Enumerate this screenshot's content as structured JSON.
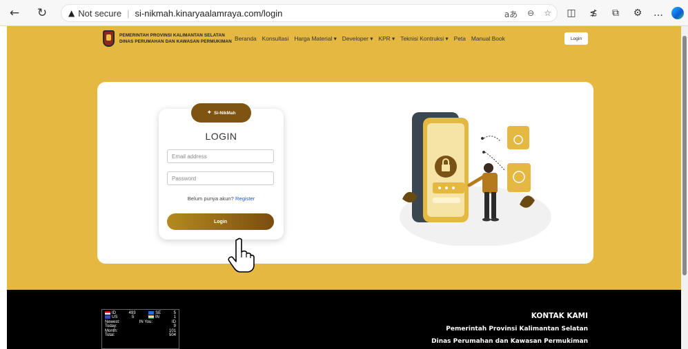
{
  "browser": {
    "security_text": "Not secure",
    "url": "si-nikmah.kinaryaalamraya.com/login",
    "icons": [
      "back-arrow-icon",
      "reload-icon",
      "warning-icon",
      "read-aloud-icon",
      "zoom-icon",
      "favorite-icon",
      "split-screen-icon",
      "favorites-list-icon",
      "collections-icon",
      "extensions-icon",
      "more-icon",
      "edge-copilot-icon"
    ]
  },
  "header": {
    "org_line1": "PEMERINTAH PROVINSI KALIMANTAN SELATAN",
    "org_line2": "DINAS PERUMAHAN DAN KAWASAN PERMUKIMAN",
    "menu": [
      "Beranda",
      "Konsultasi",
      "Harga Material ▾",
      "Developer ▾",
      "KPR ▾",
      "Teknisi Kontruksi ▾",
      "Peta",
      "Manual Book"
    ],
    "login_label": "Login"
  },
  "login": {
    "brand": "Si-NikMah",
    "title": "LOGIN",
    "email_placeholder": "Email address",
    "password_placeholder": "Password",
    "register_prompt": "Belum punya akun?",
    "register_link": "Register",
    "submit_label": "Login"
  },
  "footer": {
    "counter": {
      "rows": [
        [
          "ID",
          "493",
          "SE",
          "5"
        ],
        [
          "US",
          "5",
          "IN",
          "1"
        ]
      ],
      "newest_label": "Newest:",
      "you_label": "IN You:",
      "you_country": "ID",
      "today_label": "Today:",
      "today_value": "9",
      "month_label": "Month:",
      "month_value": "101",
      "total_label": "Total:",
      "total_value": "504"
    },
    "contact_heading": "KONTAK KAMI",
    "contact_line1": "Pemerintah Provinsi Kalimantan Selatan",
    "contact_line2": "Dinas Perumahan dan Kawasan Permukiman"
  },
  "colors": {
    "page_bg": "#e5b842",
    "brand_brown": "#7f5311",
    "link_blue": "#1f5bd3",
    "footer_bg": "#000000"
  }
}
